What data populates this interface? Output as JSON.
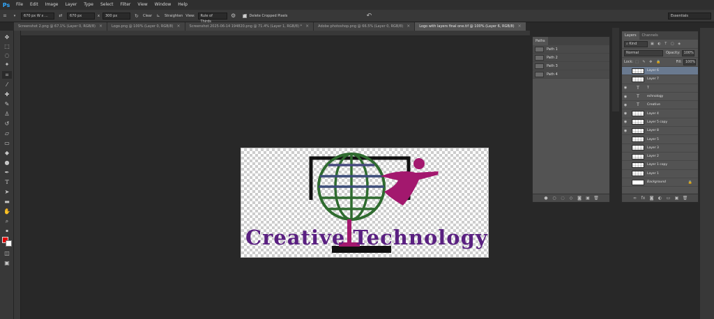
{
  "app": {
    "logo": "Ps"
  },
  "menu": [
    "File",
    "Edit",
    "Image",
    "Layer",
    "Type",
    "Select",
    "Filter",
    "View",
    "Window",
    "Help"
  ],
  "options": {
    "preset": "670 px  W x ...",
    "width": "670 px",
    "x_sep": "x",
    "height": "300 px",
    "clear": "Clear",
    "straighten": "Straighten",
    "view_label": "View:",
    "view_value": "Rule of Thirds",
    "delete_cropped": "Delete Cropped Pixels"
  },
  "workspace": "Essentials",
  "tabs": [
    {
      "label": "Screenshot 2.png @ 67.1% (Layer 0, RGB/8)"
    },
    {
      "label": "Logo.png @ 100% (Layer 0, RGB/8)"
    },
    {
      "label": "Screenshot 2025-06-14 194820.png @ 71.4% (Layer 1, RGB/8) *"
    },
    {
      "label": "Adobe photoshop.png @ 66.5% (Layer 0, RGB/8)"
    },
    {
      "label": "Logo with layers final one.tif @ 100% (Layer 6, RGB/8)"
    }
  ],
  "canvas": {
    "logo_text": "Creative Technology"
  },
  "paths_panel": {
    "title": "Paths",
    "items": [
      "Path 1",
      "Path 2",
      "Path 3",
      "Path 4"
    ]
  },
  "layers_panel": {
    "tabs": [
      "Layers",
      "Channels"
    ],
    "kind": "Kind",
    "blend": "Normal",
    "opacity_label": "Opacity:",
    "opacity": "100%",
    "lock_label": "Lock:",
    "fill_label": "Fill:",
    "fill": "100%",
    "layers": [
      {
        "name": "Layer 6",
        "type": "pixel",
        "selected": true,
        "visible": false
      },
      {
        "name": "Layer 7",
        "type": "pixel",
        "visible": false
      },
      {
        "name": "T",
        "type": "text",
        "visible": true
      },
      {
        "name": "echnology",
        "type": "text",
        "visible": true
      },
      {
        "name": "Creative",
        "type": "text",
        "visible": true
      },
      {
        "name": "Layer 4",
        "type": "pixel",
        "visible": true
      },
      {
        "name": "Layer 5 copy",
        "type": "pixel",
        "visible": true
      },
      {
        "name": "Layer 8",
        "type": "pixel",
        "visible": true
      },
      {
        "name": "Layer 5",
        "type": "pixel",
        "visible": false
      },
      {
        "name": "Layer 3",
        "type": "pixel",
        "visible": false
      },
      {
        "name": "Layer 2",
        "type": "pixel",
        "visible": false
      },
      {
        "name": "Layer 1 copy",
        "type": "pixel",
        "visible": false
      },
      {
        "name": "Layer 1",
        "type": "pixel",
        "visible": false
      },
      {
        "name": "Background",
        "type": "background",
        "visible": false
      }
    ]
  },
  "colors": {
    "foreground": "#e00000",
    "background": "#ffffff",
    "logo_purple": "#5a2081",
    "logo_green": "#2f6b2f",
    "logo_magenta": "#a3186e"
  }
}
